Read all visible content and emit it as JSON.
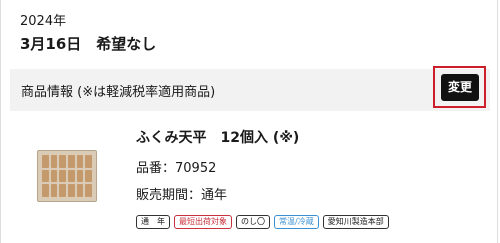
{
  "date": {
    "year": "2024年",
    "line": "3月16日　希望なし"
  },
  "section": {
    "title": "商品情報 (※は軽減税率適用商品)",
    "change_button": "変更"
  },
  "product": {
    "name": "ふくみ天平　12個入 (※)",
    "code": "品番：70952",
    "period": "販売期間：通年",
    "tags": [
      "通　年",
      "最短出荷対象",
      "のし〇",
      "常温/冷蔵",
      "愛知川製造本部"
    ]
  },
  "colors": {
    "highlight": "#cc1f2b",
    "tag_red": "#c8323c",
    "tag_blue": "#3a8fd0"
  }
}
